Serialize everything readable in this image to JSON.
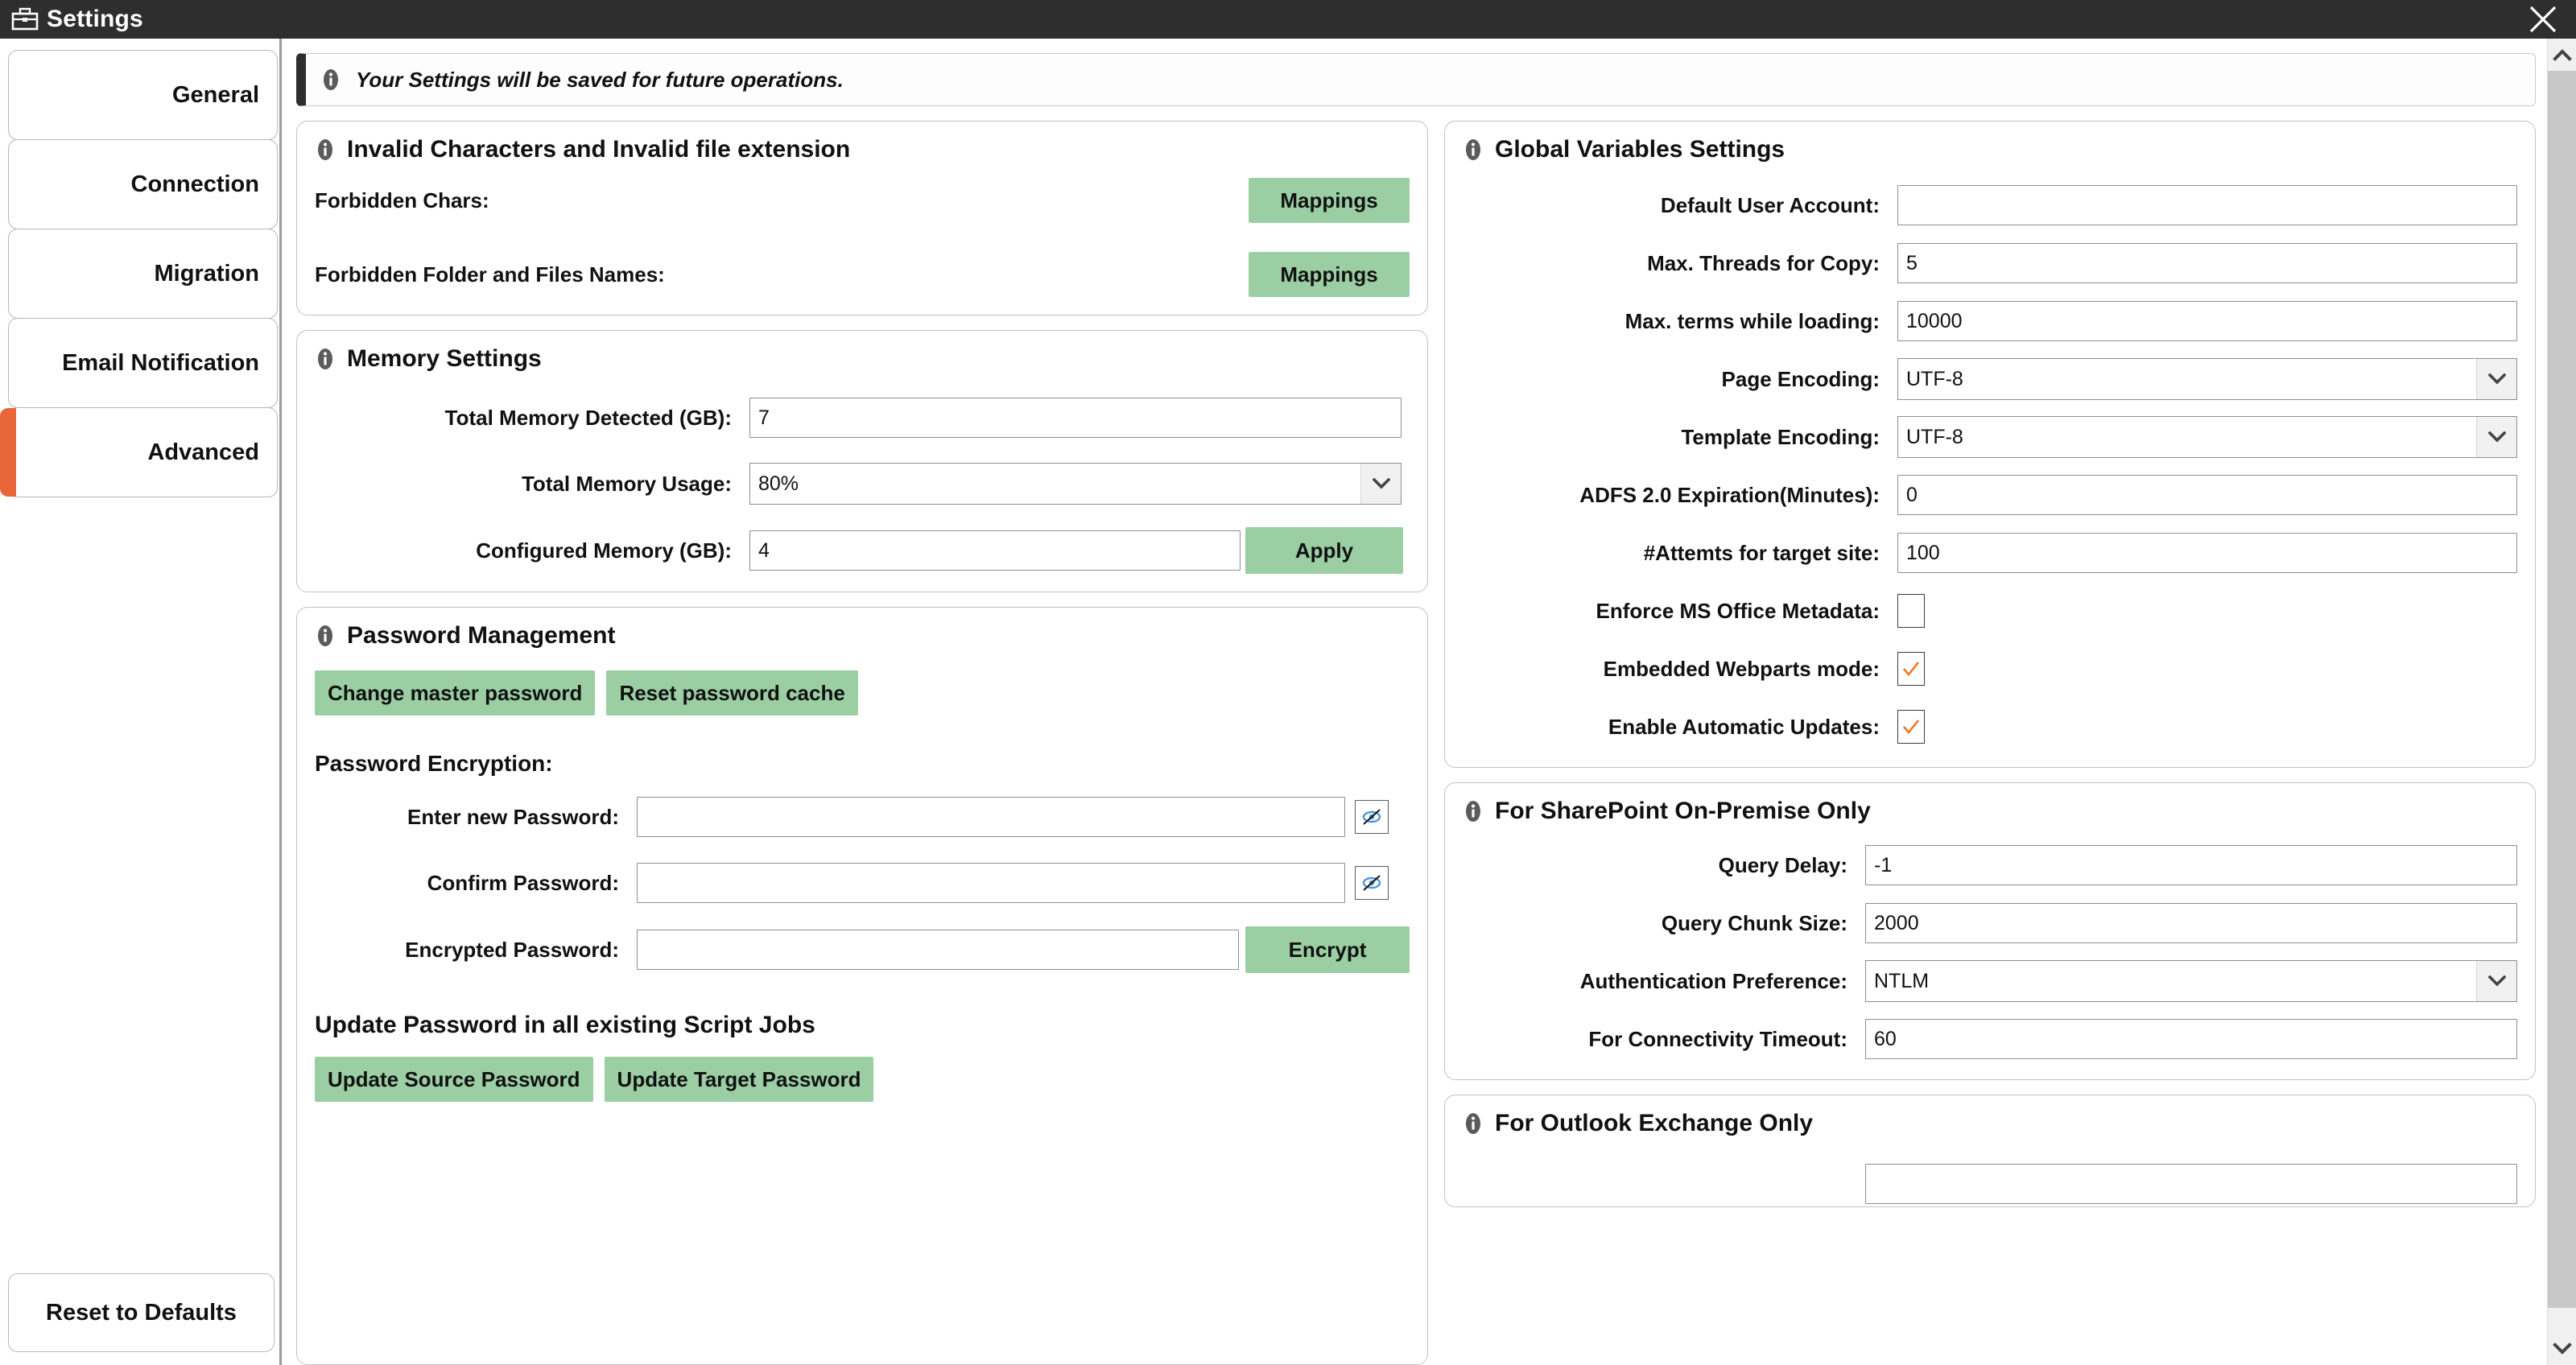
{
  "window": {
    "title": "Settings",
    "icon": "briefcase-icon",
    "close_label": "close-icon"
  },
  "sidebar": {
    "tabs": [
      {
        "label": "General",
        "active": false
      },
      {
        "label": "Connection",
        "active": false
      },
      {
        "label": "Migration",
        "active": false
      },
      {
        "label": "Email Notification",
        "active": false
      },
      {
        "label": "Advanced",
        "active": true
      }
    ],
    "reset_button": "Reset to Defaults"
  },
  "banner": {
    "icon": "info-icon",
    "text": "Your Settings will be saved for future operations."
  },
  "invalid_chars": {
    "title": "Invalid Characters and Invalid file extension",
    "rows": [
      {
        "label": "Forbidden Chars:",
        "button": "Mappings"
      },
      {
        "label": "Forbidden Folder and Files Names:",
        "button": "Mappings"
      }
    ]
  },
  "memory": {
    "title": "Memory Settings",
    "total_detected_label": "Total Memory Detected (GB):",
    "total_detected_value": "7",
    "total_usage_label": "Total Memory Usage:",
    "total_usage_value": "80%",
    "configured_label": "Configured Memory (GB):",
    "configured_value": "4",
    "apply_button": "Apply"
  },
  "password": {
    "title": "Password Management",
    "change_master_button": "Change master password",
    "reset_cache_button": "Reset password cache",
    "encryption_heading": "Password Encryption:",
    "new_password_label": "Enter new Password:",
    "new_password_value": "",
    "confirm_password_label": "Confirm Password:",
    "confirm_password_value": "",
    "encrypted_password_label": "Encrypted Password:",
    "encrypted_password_value": "",
    "encrypt_button": "Encrypt",
    "update_heading": "Update Password in all existing Script Jobs",
    "update_source_button": "Update Source Password",
    "update_target_button": "Update Target Password"
  },
  "global_vars": {
    "title": "Global Variables Settings",
    "fields": [
      {
        "label": "Default User Account:",
        "value": "",
        "type": "text"
      },
      {
        "label": "Max. Threads for Copy:",
        "value": "5",
        "type": "text"
      },
      {
        "label": "Max. terms while loading:",
        "value": "10000",
        "type": "text"
      },
      {
        "label": "Page Encoding:",
        "value": "UTF-8",
        "type": "select"
      },
      {
        "label": "Template Encoding:",
        "value": "UTF-8",
        "type": "select"
      },
      {
        "label": "ADFS 2.0 Expiration(Minutes):",
        "value": "0",
        "type": "text"
      },
      {
        "label": "#Attemts for target site:",
        "value": "100",
        "type": "text"
      },
      {
        "label": "Enforce MS Office Metadata:",
        "checked": false,
        "type": "checkbox"
      },
      {
        "label": "Embedded Webparts mode:",
        "checked": true,
        "type": "checkbox"
      },
      {
        "label": "Enable Automatic Updates:",
        "checked": true,
        "type": "checkbox"
      }
    ]
  },
  "sharepoint": {
    "title": "For SharePoint On-Premise Only",
    "fields": [
      {
        "label": "Query Delay:",
        "value": "-1",
        "type": "text"
      },
      {
        "label": "Query Chunk Size:",
        "value": "2000",
        "type": "text"
      },
      {
        "label": "Authentication Preference:",
        "value": "NTLM",
        "type": "select"
      },
      {
        "label": "For Connectivity Timeout:",
        "value": "60",
        "type": "text"
      }
    ]
  },
  "outlook": {
    "title": "For Outlook Exchange Only"
  },
  "colors": {
    "titlebar_bg": "#2e2e2e",
    "accent_orange": "#e8663a",
    "button_green": "#9bcfa3",
    "check_orange": "#ef7622"
  }
}
